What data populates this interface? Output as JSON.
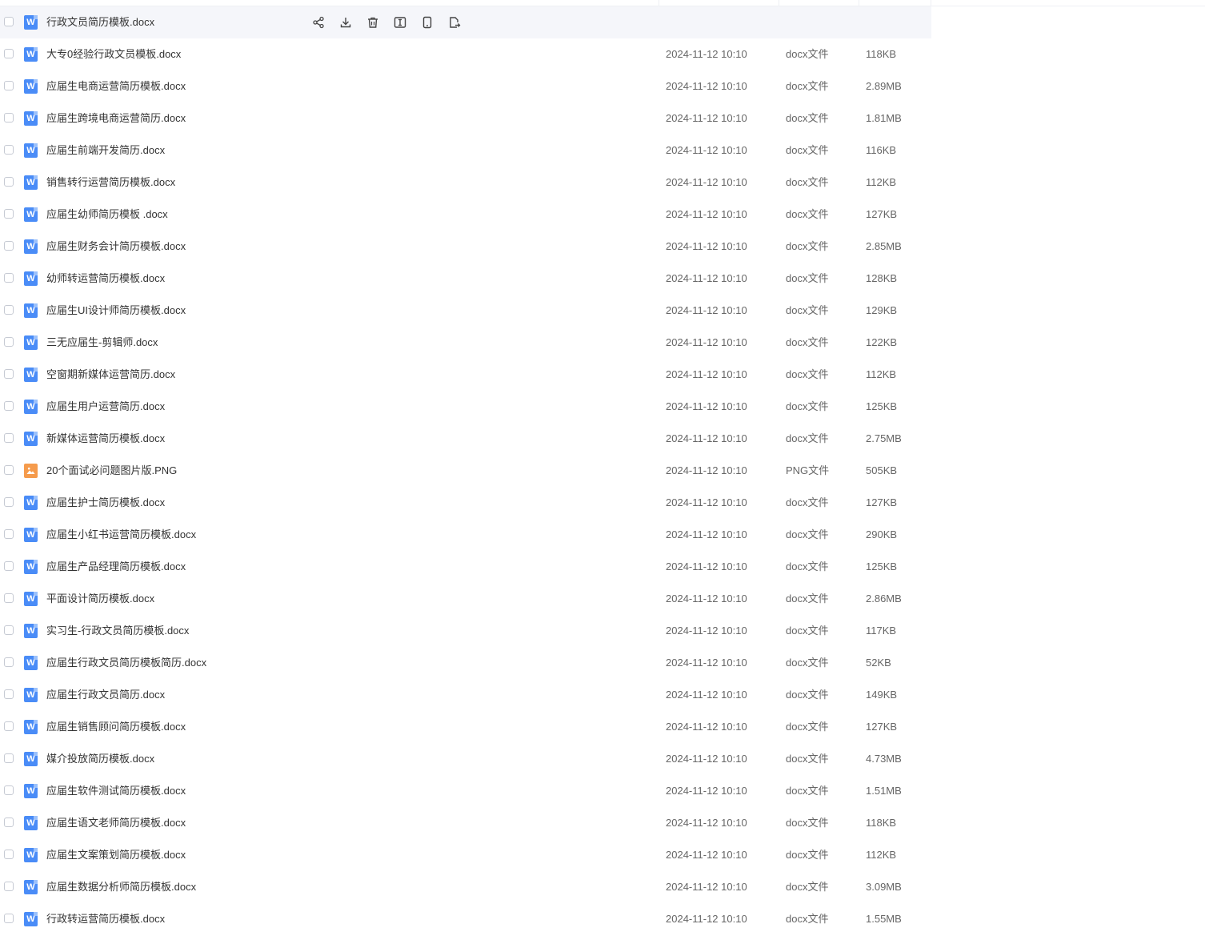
{
  "accent_color": "#4a8cf7",
  "image_icon_color": "#f59b4c",
  "hover_actions": [
    {
      "name": "share-icon"
    },
    {
      "name": "download-icon"
    },
    {
      "name": "trash-icon"
    },
    {
      "name": "rename-icon"
    },
    {
      "name": "mobile-icon"
    },
    {
      "name": "move-icon"
    }
  ],
  "files": [
    {
      "name": "行政文员简历模板.docx",
      "date": "",
      "type": "",
      "size": "",
      "icon": "word-icon",
      "icon_letter": "W",
      "hovered": true
    },
    {
      "name": "大专0经验行政文员模板.docx",
      "date": "2024-11-12 10:10",
      "type": "docx文件",
      "size": "118KB",
      "icon": "word-icon",
      "icon_letter": "W"
    },
    {
      "name": "应届生电商运营简历模板.docx",
      "date": "2024-11-12 10:10",
      "type": "docx文件",
      "size": "2.89MB",
      "icon": "word-icon",
      "icon_letter": "W"
    },
    {
      "name": "应届生跨境电商运营简历.docx",
      "date": "2024-11-12 10:10",
      "type": "docx文件",
      "size": "1.81MB",
      "icon": "word-icon",
      "icon_letter": "W"
    },
    {
      "name": "应届生前端开发简历.docx",
      "date": "2024-11-12 10:10",
      "type": "docx文件",
      "size": "116KB",
      "icon": "word-icon",
      "icon_letter": "W"
    },
    {
      "name": "销售转行运营简历模板.docx",
      "date": "2024-11-12 10:10",
      "type": "docx文件",
      "size": "112KB",
      "icon": "word-icon",
      "icon_letter": "W"
    },
    {
      "name": "应届生幼师简历模板 .docx",
      "date": "2024-11-12 10:10",
      "type": "docx文件",
      "size": "127KB",
      "icon": "word-icon",
      "icon_letter": "W"
    },
    {
      "name": "应届生财务会计简历模板.docx",
      "date": "2024-11-12 10:10",
      "type": "docx文件",
      "size": "2.85MB",
      "icon": "word-icon",
      "icon_letter": "W"
    },
    {
      "name": "幼师转运营简历模板.docx",
      "date": "2024-11-12 10:10",
      "type": "docx文件",
      "size": "128KB",
      "icon": "word-icon",
      "icon_letter": "W"
    },
    {
      "name": "应届生UI设计师简历模板.docx",
      "date": "2024-11-12 10:10",
      "type": "docx文件",
      "size": "129KB",
      "icon": "word-icon",
      "icon_letter": "W"
    },
    {
      "name": "三无应届生-剪辑师.docx",
      "date": "2024-11-12 10:10",
      "type": "docx文件",
      "size": "122KB",
      "icon": "word-icon",
      "icon_letter": "W"
    },
    {
      "name": "空窗期新媒体运营简历.docx",
      "date": "2024-11-12 10:10",
      "type": "docx文件",
      "size": "112KB",
      "icon": "word-icon",
      "icon_letter": "W"
    },
    {
      "name": "应届生用户运营简历.docx",
      "date": "2024-11-12 10:10",
      "type": "docx文件",
      "size": "125KB",
      "icon": "word-icon",
      "icon_letter": "W"
    },
    {
      "name": "新媒体运营简历模板.docx",
      "date": "2024-11-12 10:10",
      "type": "docx文件",
      "size": "2.75MB",
      "icon": "word-icon",
      "icon_letter": "W"
    },
    {
      "name": "20个面试必问题图片版.PNG",
      "date": "2024-11-12 10:10",
      "type": "PNG文件",
      "size": "505KB",
      "icon": "image-icon",
      "icon_letter": ""
    },
    {
      "name": "应届生护士简历模板.docx",
      "date": "2024-11-12 10:10",
      "type": "docx文件",
      "size": "127KB",
      "icon": "word-icon",
      "icon_letter": "W"
    },
    {
      "name": "应届生小红书运营简历模板.docx",
      "date": "2024-11-12 10:10",
      "type": "docx文件",
      "size": "290KB",
      "icon": "word-icon",
      "icon_letter": "W"
    },
    {
      "name": "应届生产品经理简历模板.docx",
      "date": "2024-11-12 10:10",
      "type": "docx文件",
      "size": "125KB",
      "icon": "word-icon",
      "icon_letter": "W"
    },
    {
      "name": "平面设计简历模板.docx",
      "date": "2024-11-12 10:10",
      "type": "docx文件",
      "size": "2.86MB",
      "icon": "word-icon",
      "icon_letter": "W"
    },
    {
      "name": "实习生-行政文员简历模板.docx",
      "date": "2024-11-12 10:10",
      "type": "docx文件",
      "size": "117KB",
      "icon": "word-icon",
      "icon_letter": "W"
    },
    {
      "name": "应届生行政文员简历模板简历.docx",
      "date": "2024-11-12 10:10",
      "type": "docx文件",
      "size": "52KB",
      "icon": "word-icon",
      "icon_letter": "W"
    },
    {
      "name": "应届生行政文员简历.docx",
      "date": "2024-11-12 10:10",
      "type": "docx文件",
      "size": "149KB",
      "icon": "word-icon",
      "icon_letter": "W"
    },
    {
      "name": "应届生销售顾问简历模板.docx",
      "date": "2024-11-12 10:10",
      "type": "docx文件",
      "size": "127KB",
      "icon": "word-icon",
      "icon_letter": "W"
    },
    {
      "name": "媒介投放简历模板.docx",
      "date": "2024-11-12 10:10",
      "type": "docx文件",
      "size": "4.73MB",
      "icon": "word-icon",
      "icon_letter": "W"
    },
    {
      "name": "应届生软件测试简历模板.docx",
      "date": "2024-11-12 10:10",
      "type": "docx文件",
      "size": "1.51MB",
      "icon": "word-icon",
      "icon_letter": "W"
    },
    {
      "name": "应届生语文老师简历模板.docx",
      "date": "2024-11-12 10:10",
      "type": "docx文件",
      "size": "118KB",
      "icon": "word-icon",
      "icon_letter": "W"
    },
    {
      "name": "应届生文案策划简历模板.docx",
      "date": "2024-11-12 10:10",
      "type": "docx文件",
      "size": "112KB",
      "icon": "word-icon",
      "icon_letter": "W"
    },
    {
      "name": "应届生数据分析师简历模板.docx",
      "date": "2024-11-12 10:10",
      "type": "docx文件",
      "size": "3.09MB",
      "icon": "word-icon",
      "icon_letter": "W"
    },
    {
      "name": "行政转运营简历模板.docx",
      "date": "2024-11-12 10:10",
      "type": "docx文件",
      "size": "1.55MB",
      "icon": "word-icon",
      "icon_letter": "W"
    }
  ]
}
